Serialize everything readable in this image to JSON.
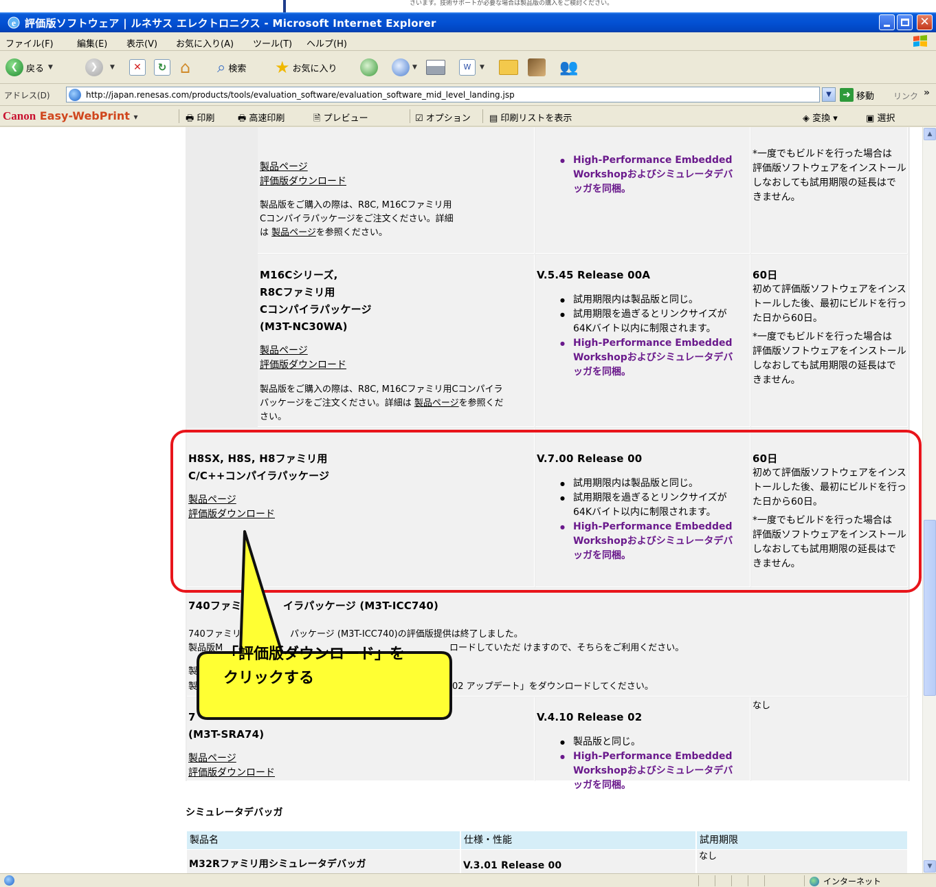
{
  "top_strip": {
    "text": "さいます。技術サポートが必要な場合は製品版の購入をご検討ください。"
  },
  "window": {
    "title": "評価版ソフトウェア | ルネサス エレクトロニクス - Microsoft Internet Explorer",
    "buttons": {
      "minimize": "_",
      "maximize": "□",
      "close": "✕"
    }
  },
  "menu": [
    "ファイル(F)",
    "編集(E)",
    "表示(V)",
    "お気に入り(A)",
    "ツール(T)",
    "ヘルプ(H)"
  ],
  "toolbar": {
    "back": "戻る",
    "search": "検索",
    "favorites": "お気に入り"
  },
  "address": {
    "label": "アドレス(D)",
    "url": "http://japan.renesas.com/products/tools/evaluation_software/evaluation_software_mid_level_landing.jsp",
    "go": "移動",
    "links": "リンク",
    "chevron": "»"
  },
  "printbar": {
    "brand_canon": "Canon",
    "brand_ewp": "Easy-WebPrint",
    "brand_arrow": "▾",
    "items": [
      "印刷",
      "高速印刷",
      "プレビュー",
      "オプション",
      "印刷リストを表示"
    ],
    "convert": "変換",
    "select": "選択"
  },
  "content": {
    "row0": {
      "link_product": "製品ページ",
      "link_download": "評価版ダウンロード",
      "note_lines": [
        "製品版をご購入の際は、R8C, M16Cファミリ用",
        "Cコンパイラパッケージをご注文ください。詳細",
        "は"
      ],
      "note_link": "製品ページ",
      "note_tail": "を参照ください。",
      "spec_purple_lines": [
        "High-Performance Embedded",
        "Workshopおよびシミュレータデバ",
        "ッガを同梱。"
      ],
      "period_lines": [
        "*一度でもビルドを行った場合は",
        "評価版ソフトウェアをインストール",
        "しなおしても試用期限の延長はで",
        "きません。"
      ]
    },
    "row1": {
      "name_lines": [
        "M16Cシリーズ,",
        "R8Cファミリ用",
        "Cコンパイラパッケージ",
        "(M3T-NC30WA)"
      ],
      "link_product": "製品ページ",
      "link_download": "評価版ダウンロード",
      "note_lines": [
        "製品版をご購入の際は、R8C, M16Cファミリ用Cコンパイラ",
        "パッケージをご注文ください。詳細は",
        "さい。"
      ],
      "note_link": "製品ページ",
      "note_tail": "を参照くだ",
      "version": "V.5.45 Release 00A",
      "spec_items": [
        "試用期限内は製品版と同じ。",
        "試用期限を過ぎるとリンクサイズが",
        "64Kバイト以内に制限されます。"
      ],
      "spec_purple_lines": [
        "High-Performance Embedded",
        "Workshopおよびシミュレータデバ",
        "ッガを同梱。"
      ],
      "period_title": "60日",
      "period_lines": [
        "初めて評価版ソフトウェアをインス",
        "トールした後、最初にビルドを行っ",
        "た日から60日。",
        "*一度でもビルドを行った場合は",
        "評価版ソフトウェアをインストール",
        "しなおしても試用期限の延長はで",
        "きません。"
      ]
    },
    "row2": {
      "name_lines": [
        "H8SX, H8S, H8ファミリ用",
        "C/C++コンパイラパッケージ"
      ],
      "link_product": "製品ページ",
      "link_download": "評価版ダウンロード",
      "version": "V.7.00 Release 00",
      "spec_items": [
        "試用期限内は製品版と同じ。",
        "試用期限を過ぎるとリンクサイズが",
        "64Kバイト以内に制限されます。"
      ],
      "spec_purple_lines": [
        "High-Performance Embedded",
        "Workshopおよびシミュレータデバ",
        "ッガを同梱。"
      ],
      "period_title": "60日",
      "period_lines": [
        "初めて評価版ソフトウェアをインス",
        "トールした後、最初にビルドを行っ",
        "た日から60日。",
        "*一度でもビルドを行った場合は",
        "評価版ソフトウェアをインストール",
        "しなおしても試用期限の延長はで",
        "きません。"
      ]
    },
    "row3": {
      "title_left": "740ファミ",
      "title_right": "イラパッケージ (M3T-ICC740)",
      "line1_left": "740ファミリ",
      "line1_right": "パッケージ (M3T-ICC740)の評価版提供は終了しました。",
      "line2_left": "製品版M",
      "line2_right": "ロードしていただ けますので、そちらをご利用ください。",
      "line3_left": "製",
      "line4_left": "製",
      "line4_right": "02 アップデート」をダウンロードしてください。"
    },
    "row4": {
      "name_lead": "7",
      "name_line2": "(M3T-SRA74)",
      "link_product": "製品ページ",
      "link_download": "評価版ダウンロード",
      "version": "V.4.10 Release 02",
      "spec_items": [
        "製品版と同じ。"
      ],
      "spec_purple_lines": [
        "High-Performance Embedded",
        "Workshopおよびシミュレータデバ",
        "ッガを同梱。"
      ],
      "period": "なし"
    },
    "simulator": {
      "heading": "シミュレータデバッガ",
      "headers": [
        "製品名",
        "仕様・性能",
        "試用期限"
      ],
      "row": {
        "name": "M32Rファミリ用シミュレータデバッガ",
        "version": "V.3.01 Release 00",
        "period": "なし"
      }
    }
  },
  "callout": {
    "lines": [
      "「評価版ダウンロード」を",
      "クリックする"
    ]
  },
  "status": {
    "zone": "インターネット"
  },
  "colors": {
    "highlight": "#e8151b",
    "callout": "#ffff33",
    "purple": "#6a1a8c",
    "titlebar": "#0351d4"
  }
}
